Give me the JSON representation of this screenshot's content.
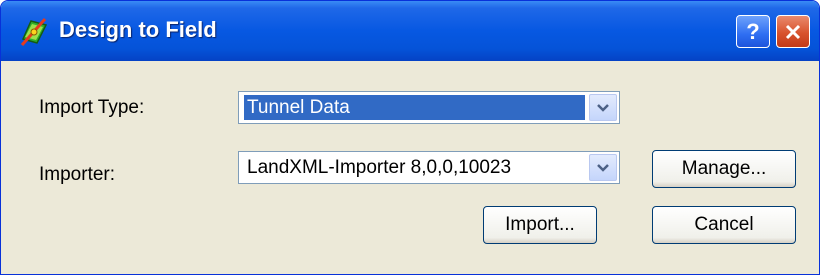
{
  "window": {
    "title": "Design to Field",
    "help_glyph": "?",
    "icons": {
      "app": "app-icon",
      "help": "help-icon",
      "close": "close-icon"
    }
  },
  "form": {
    "import_type_label": "Import Type:",
    "import_type_value": "Tunnel Data",
    "importer_label": "Importer:",
    "importer_value": "LandXML-Importer 8,0,0,10023"
  },
  "buttons": {
    "manage": "Manage...",
    "import": "Import...",
    "cancel": "Cancel"
  },
  "colors": {
    "titlebar": "#0758e2",
    "selection": "#316ac5",
    "dialog_bg": "#ece9d8",
    "close_button": "#d8532d"
  }
}
